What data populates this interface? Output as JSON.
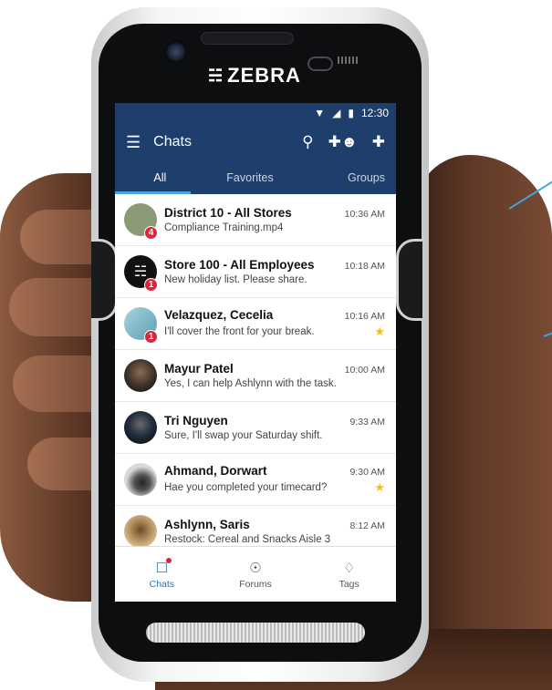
{
  "device": {
    "brand": "ZEBRA"
  },
  "status_bar": {
    "time": "12:30"
  },
  "app_bar": {
    "title": "Chats",
    "menu_icon": "hamburger-icon",
    "actions": [
      "search-icon",
      "add-group-icon",
      "plus-icon"
    ]
  },
  "tabs": [
    {
      "label": "All",
      "active": true
    },
    {
      "label": "Favorites",
      "active": false
    },
    {
      "label": "Groups",
      "active": false
    }
  ],
  "chats": [
    {
      "name": "District 10 - All Stores",
      "message": "Compliance Training.mp4",
      "time": "10:36 AM",
      "badge": "4",
      "starred": false,
      "avatar_color": "#8a9a74"
    },
    {
      "name": "Store 100 - All Employees",
      "message": "New holiday list. Please share.",
      "time": "10:18 AM",
      "badge": "1",
      "starred": false,
      "avatar_color": "#111111"
    },
    {
      "name": "Velazquez, Cecelia",
      "message": "I'll cover the front for your break.",
      "time": "10:16 AM",
      "badge": "1",
      "starred": true,
      "avatar_color": "#7fb9c9"
    },
    {
      "name": "Mayur Patel",
      "message": "Yes, I can help Ashlynn with the task.",
      "time": "10:00 AM",
      "badge": "",
      "starred": false,
      "avatar_color": "#4a3a30"
    },
    {
      "name": "Tri Nguyen",
      "message": "Sure, I'll swap your Saturday shift.",
      "time": "9:33 AM",
      "badge": "",
      "starred": false,
      "avatar_color": "#243040"
    },
    {
      "name": "Ahmand, Dorwart",
      "message": "Hae you completed your timecard?",
      "time": "9:30 AM",
      "badge": "",
      "starred": true,
      "avatar_color": "#c9c9c9"
    },
    {
      "name": "Ashlynn, Saris",
      "message": "Restock: Cereal and Snacks Aisle 3",
      "time": "8:12 AM",
      "badge": "",
      "starred": false,
      "avatar_color": "#b08a5a"
    }
  ],
  "bottom_nav": [
    {
      "label": "Chats",
      "icon": "chat-icon",
      "active": true
    },
    {
      "label": "Forums",
      "icon": "compass-icon",
      "active": false
    },
    {
      "label": "Tags",
      "icon": "tag-icon",
      "active": false
    }
  ],
  "colors": {
    "app_bar": "#1e3f6b",
    "accent": "#1c7ac1",
    "badge": "#d7263d",
    "star": "#f4c020"
  }
}
